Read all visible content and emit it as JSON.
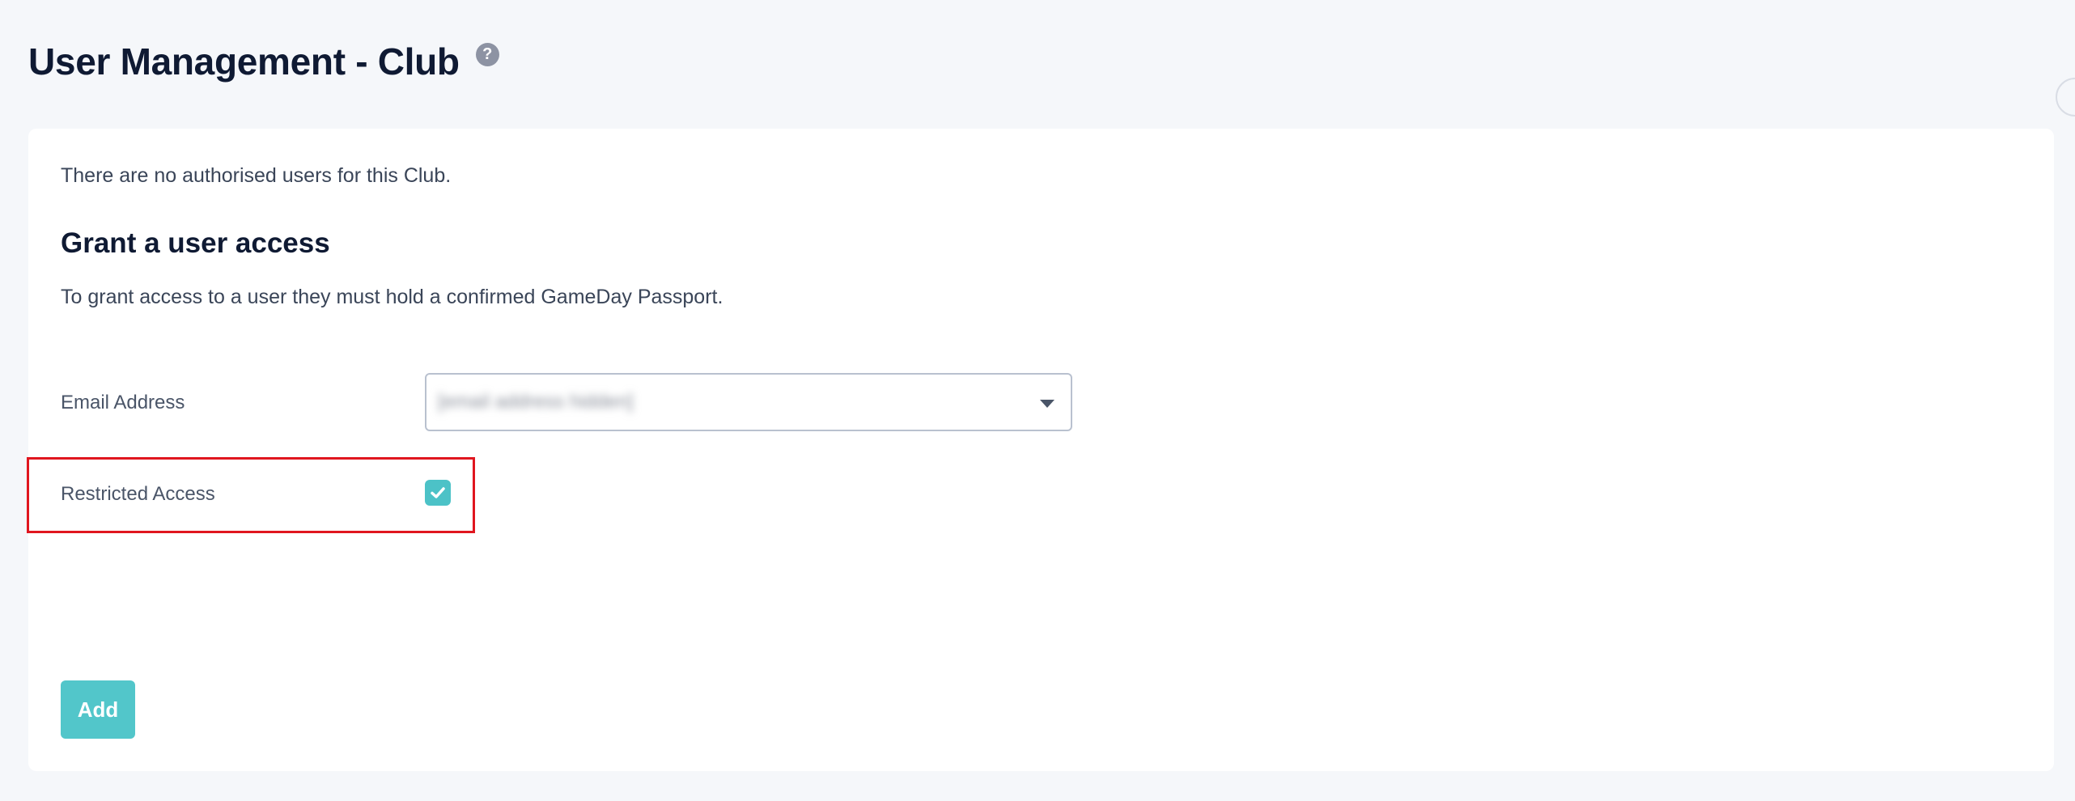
{
  "header": {
    "title": "User Management - Club",
    "help_icon": "question-circle-icon",
    "help_symbol": "?"
  },
  "card": {
    "notice": "There are no authorised users for this Club.",
    "section_title": "Grant a user access",
    "section_desc": "To grant access to a user they must hold a confirmed GameDay Passport."
  },
  "form": {
    "email_label": "Email Address",
    "email_value": "[email address hidden]",
    "email_value_blurred": true,
    "restricted_label": "Restricted Access",
    "restricted_checked": true,
    "add_label": "Add"
  },
  "colors": {
    "accent": "#52c6ca",
    "highlight": "#e0161f",
    "title": "#0f1a33"
  }
}
